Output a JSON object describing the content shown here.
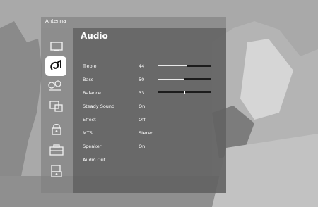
{
  "menu": {
    "title": "Antenna"
  },
  "page": {
    "title": "Audio"
  },
  "sidebar": {
    "icons": [
      {
        "name": "picture-icon",
        "selected": false
      },
      {
        "name": "audio-icon",
        "selected": true
      },
      {
        "name": "setup-icon",
        "selected": false
      },
      {
        "name": "channel-icon",
        "selected": false
      },
      {
        "name": "lock-icon",
        "selected": false
      },
      {
        "name": "options-icon",
        "selected": false
      },
      {
        "name": "input-icon",
        "selected": false
      }
    ]
  },
  "settings": [
    {
      "label": "Treble",
      "value": "44",
      "level": 0.44
    },
    {
      "label": "Bass",
      "value": "50",
      "level": 0.5
    },
    {
      "label": "Balance",
      "value": "33",
      "level": 0.33,
      "centered": true
    },
    {
      "label": "Steady Sound",
      "value": "On"
    },
    {
      "label": "Effect",
      "value": "Off"
    },
    {
      "label": "MTS",
      "value": "Stereo"
    },
    {
      "label": "Speaker",
      "value": "On"
    },
    {
      "label": "Audio Out",
      "value": ""
    }
  ]
}
